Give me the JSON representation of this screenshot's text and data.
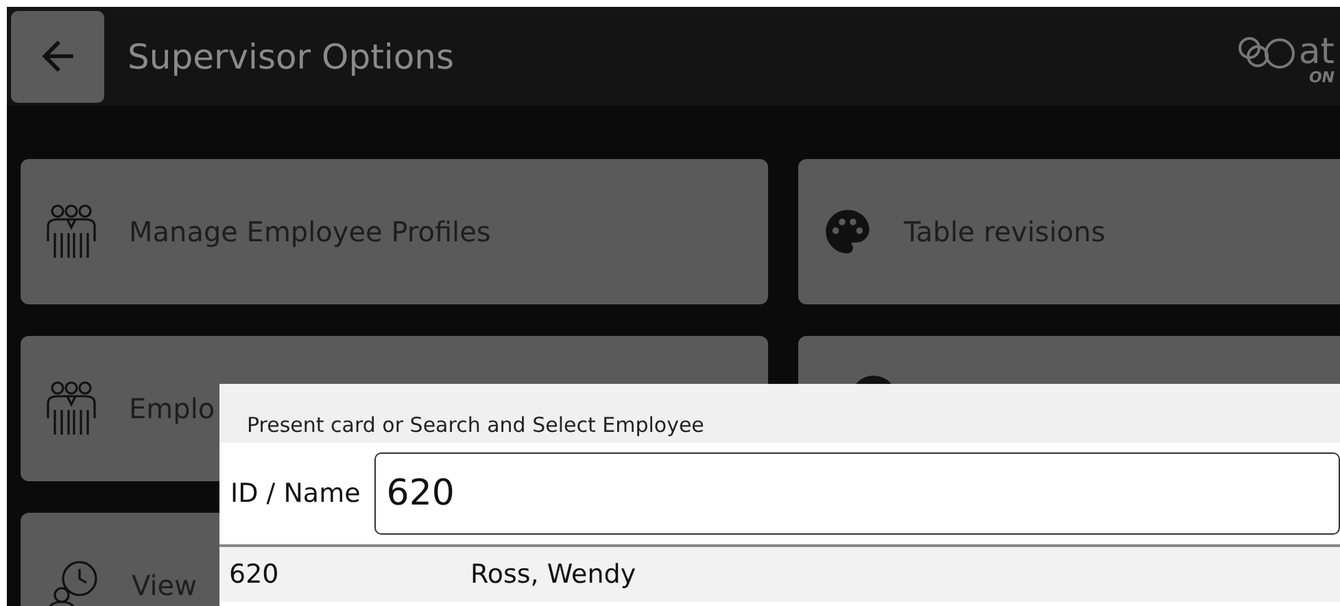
{
  "header": {
    "title": "Supervisor Options",
    "logo_text": "at",
    "logo_subtext": "ON"
  },
  "cards": [
    {
      "kind": "people",
      "label": "Manage Employee Profiles"
    },
    {
      "kind": "palette",
      "label": "Table revisions"
    },
    {
      "kind": "people",
      "label": "Emplo"
    },
    {
      "kind": "round"
    },
    {
      "kind": "clock",
      "label": "View"
    }
  ],
  "dialog": {
    "title": "Present card or Search and Select Employee",
    "field_label": "ID / Name",
    "value": "620",
    "results": [
      {
        "id": "620",
        "name": "Ross, Wendy"
      }
    ]
  }
}
